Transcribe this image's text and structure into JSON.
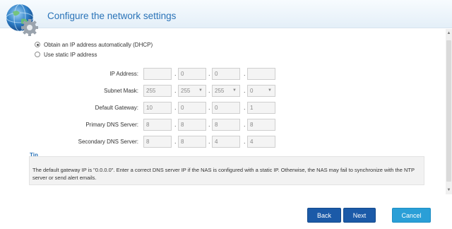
{
  "header": {
    "title": "Configure the network settings",
    "icon": "network-globe-gear-icon"
  },
  "ip_mode": {
    "options": [
      {
        "label": "Obtain an IP address automatically (DHCP)",
        "selected": true
      },
      {
        "label": "Use static IP address",
        "selected": false
      }
    ]
  },
  "fields": {
    "ip_address": {
      "label": "IP Address:",
      "octets": [
        "",
        "0",
        "0",
        ""
      ]
    },
    "subnet_mask": {
      "label": "Subnet Mask:",
      "octets": [
        "255",
        "255",
        "255",
        "0"
      ]
    },
    "default_gateway": {
      "label": "Default Gateway:",
      "octets": [
        "10",
        "0",
        "0",
        "1"
      ]
    },
    "primary_dns": {
      "label": "Primary DNS Server:",
      "octets": [
        "8",
        "8",
        "8",
        "8"
      ]
    },
    "secondary_dns": {
      "label": "Secondary DNS Server:",
      "octets": [
        "8",
        "8",
        "4",
        "4"
      ]
    },
    "separator": "."
  },
  "tip": {
    "title": "Tip",
    "text": "The default gateway IP is \"0.0.0.0\". Enter a correct DNS server IP if the NAS is configured with a static IP. Otherwise, the NAS may fail to synchronize with the NTP server or send alert emails."
  },
  "buttons": {
    "back": "Back",
    "next": "Next",
    "cancel": "Cancel"
  },
  "colors": {
    "title": "#2a73b8",
    "primary_button": "#1b5aa8",
    "cancel_button": "#2a9fd7"
  }
}
